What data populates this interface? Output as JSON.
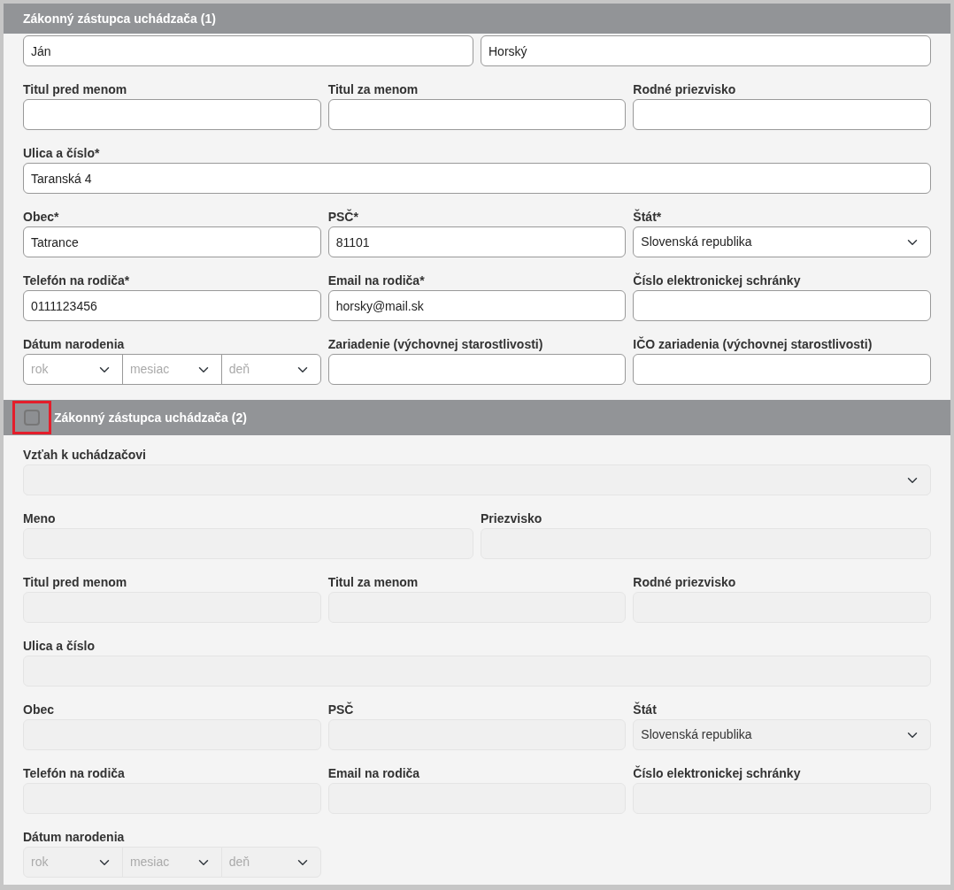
{
  "sections": [
    {
      "title": "Zákonný zástupca uchádzača (1)",
      "disabled": false,
      "rows": [
        [
          {
            "kind": "text",
            "value": "Ján"
          },
          {
            "kind": "text",
            "value": "Horský"
          }
        ],
        [
          {
            "kind": "text",
            "label": "Titul pred menom"
          },
          {
            "kind": "text",
            "label": "Titul za menom"
          },
          {
            "kind": "text",
            "label": "Rodné priezvisko"
          }
        ],
        [
          {
            "kind": "text",
            "label": "Ulica a číslo*",
            "value": "Taranská 4"
          }
        ],
        [
          {
            "kind": "text",
            "label": "Obec*",
            "value": "Tatrance"
          },
          {
            "kind": "text",
            "label": "PSČ*",
            "value": "81101"
          },
          {
            "kind": "select",
            "label": "Štát*",
            "value": "Slovenská republika"
          }
        ],
        [
          {
            "kind": "text",
            "label": "Telefón na rodiča*",
            "value": "0111123456"
          },
          {
            "kind": "text",
            "label": "Email na rodiča*",
            "value": "horsky@mail.sk"
          },
          {
            "kind": "text",
            "label": "Číslo elektronickej schránky"
          }
        ],
        [
          {
            "kind": "date",
            "label": "Dátum narodenia",
            "parts": [
              "rok",
              "mesiac",
              "deň"
            ]
          },
          {
            "kind": "text",
            "label": "Zariadenie (výchovnej starostlivosti)"
          },
          {
            "kind": "text",
            "label": "IČO zariadenia (výchovnej starostlivosti)"
          }
        ]
      ]
    },
    {
      "title": "Zákonný zástupca uchádzača (2)",
      "checkbox": {
        "checked": false,
        "highlighted": true
      },
      "disabled": true,
      "rows": [
        [
          {
            "kind": "select",
            "label": "Vzťah k uchádzačovi"
          }
        ],
        [
          {
            "kind": "text",
            "label": "Meno"
          },
          {
            "kind": "text",
            "label": "Priezvisko"
          }
        ],
        [
          {
            "kind": "text",
            "label": "Titul pred menom"
          },
          {
            "kind": "text",
            "label": "Titul za menom"
          },
          {
            "kind": "text",
            "label": "Rodné priezvisko"
          }
        ],
        [
          {
            "kind": "text",
            "label": "Ulica a číslo"
          }
        ],
        [
          {
            "kind": "text",
            "label": "Obec"
          },
          {
            "kind": "text",
            "label": "PSČ"
          },
          {
            "kind": "select",
            "label": "Štát",
            "value": "Slovenská republika"
          }
        ],
        [
          {
            "kind": "text",
            "label": "Telefón na rodiča"
          },
          {
            "kind": "text",
            "label": "Email na rodiča"
          },
          {
            "kind": "text",
            "label": "Číslo elektronickej schránky"
          }
        ],
        [
          {
            "kind": "date",
            "label": "Dátum narodenia",
            "parts": [
              "rok",
              "mesiac",
              "deň"
            ]
          }
        ]
      ]
    }
  ]
}
